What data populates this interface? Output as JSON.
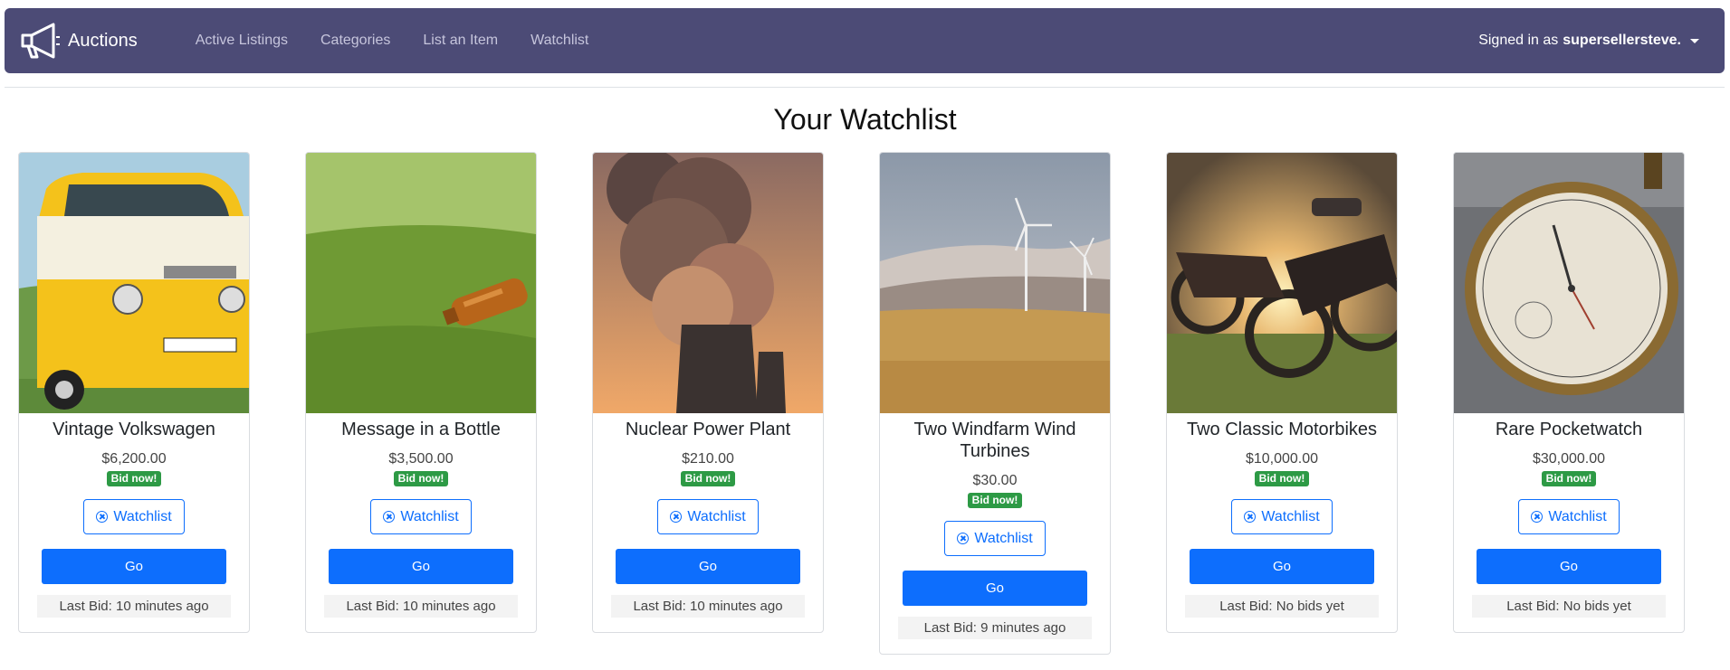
{
  "app": {
    "brand": "Auctions",
    "brand_icon": "megaphone-icon",
    "nav_links": [
      "Active Listings",
      "Categories",
      "List an Item",
      "Watchlist"
    ],
    "user_prefix": "Signed in as",
    "username": "supersellersteve."
  },
  "page": {
    "title": "Your Watchlist"
  },
  "colors": {
    "navbar": "#4c4b76",
    "primary": "#0d6efd",
    "badge": "#2d9a45"
  },
  "listings": [
    {
      "title": "Vintage Volkswagen",
      "price": "$6,200.00",
      "badge": "Bid now!",
      "watch_label": "Watchlist",
      "go_label": "Go",
      "last_bid": "Last Bid: 10 minutes ago",
      "image": "yellow-vw-van-photo"
    },
    {
      "title": "Message in a Bottle",
      "price": "$3,500.00",
      "badge": "Bid now!",
      "watch_label": "Watchlist",
      "go_label": "Go",
      "last_bid": "Last Bid: 10 minutes ago",
      "image": "bottle-in-grass-photo"
    },
    {
      "title": "Nuclear Power Plant",
      "price": "$210.00",
      "badge": "Bid now!",
      "watch_label": "Watchlist",
      "go_label": "Go",
      "last_bid": "Last Bid: 10 minutes ago",
      "image": "cooling-towers-photo"
    },
    {
      "title": "Two Windfarm Wind Turbines",
      "price": "$30.00",
      "badge": "Bid now!",
      "watch_label": "Watchlist",
      "go_label": "Go",
      "last_bid": "Last Bid: 9 minutes ago",
      "image": "wind-turbines-photo"
    },
    {
      "title": "Two Classic Motorbikes",
      "price": "$10,000.00",
      "badge": "Bid now!",
      "watch_label": "Watchlist",
      "go_label": "Go",
      "last_bid": "Last Bid: No bids yet",
      "image": "motorbikes-sunset-photo"
    },
    {
      "title": "Rare Pocketwatch",
      "price": "$30,000.00",
      "badge": "Bid now!",
      "watch_label": "Watchlist",
      "go_label": "Go",
      "last_bid": "Last Bid: No bids yet",
      "image": "pocketwatch-photo"
    }
  ]
}
